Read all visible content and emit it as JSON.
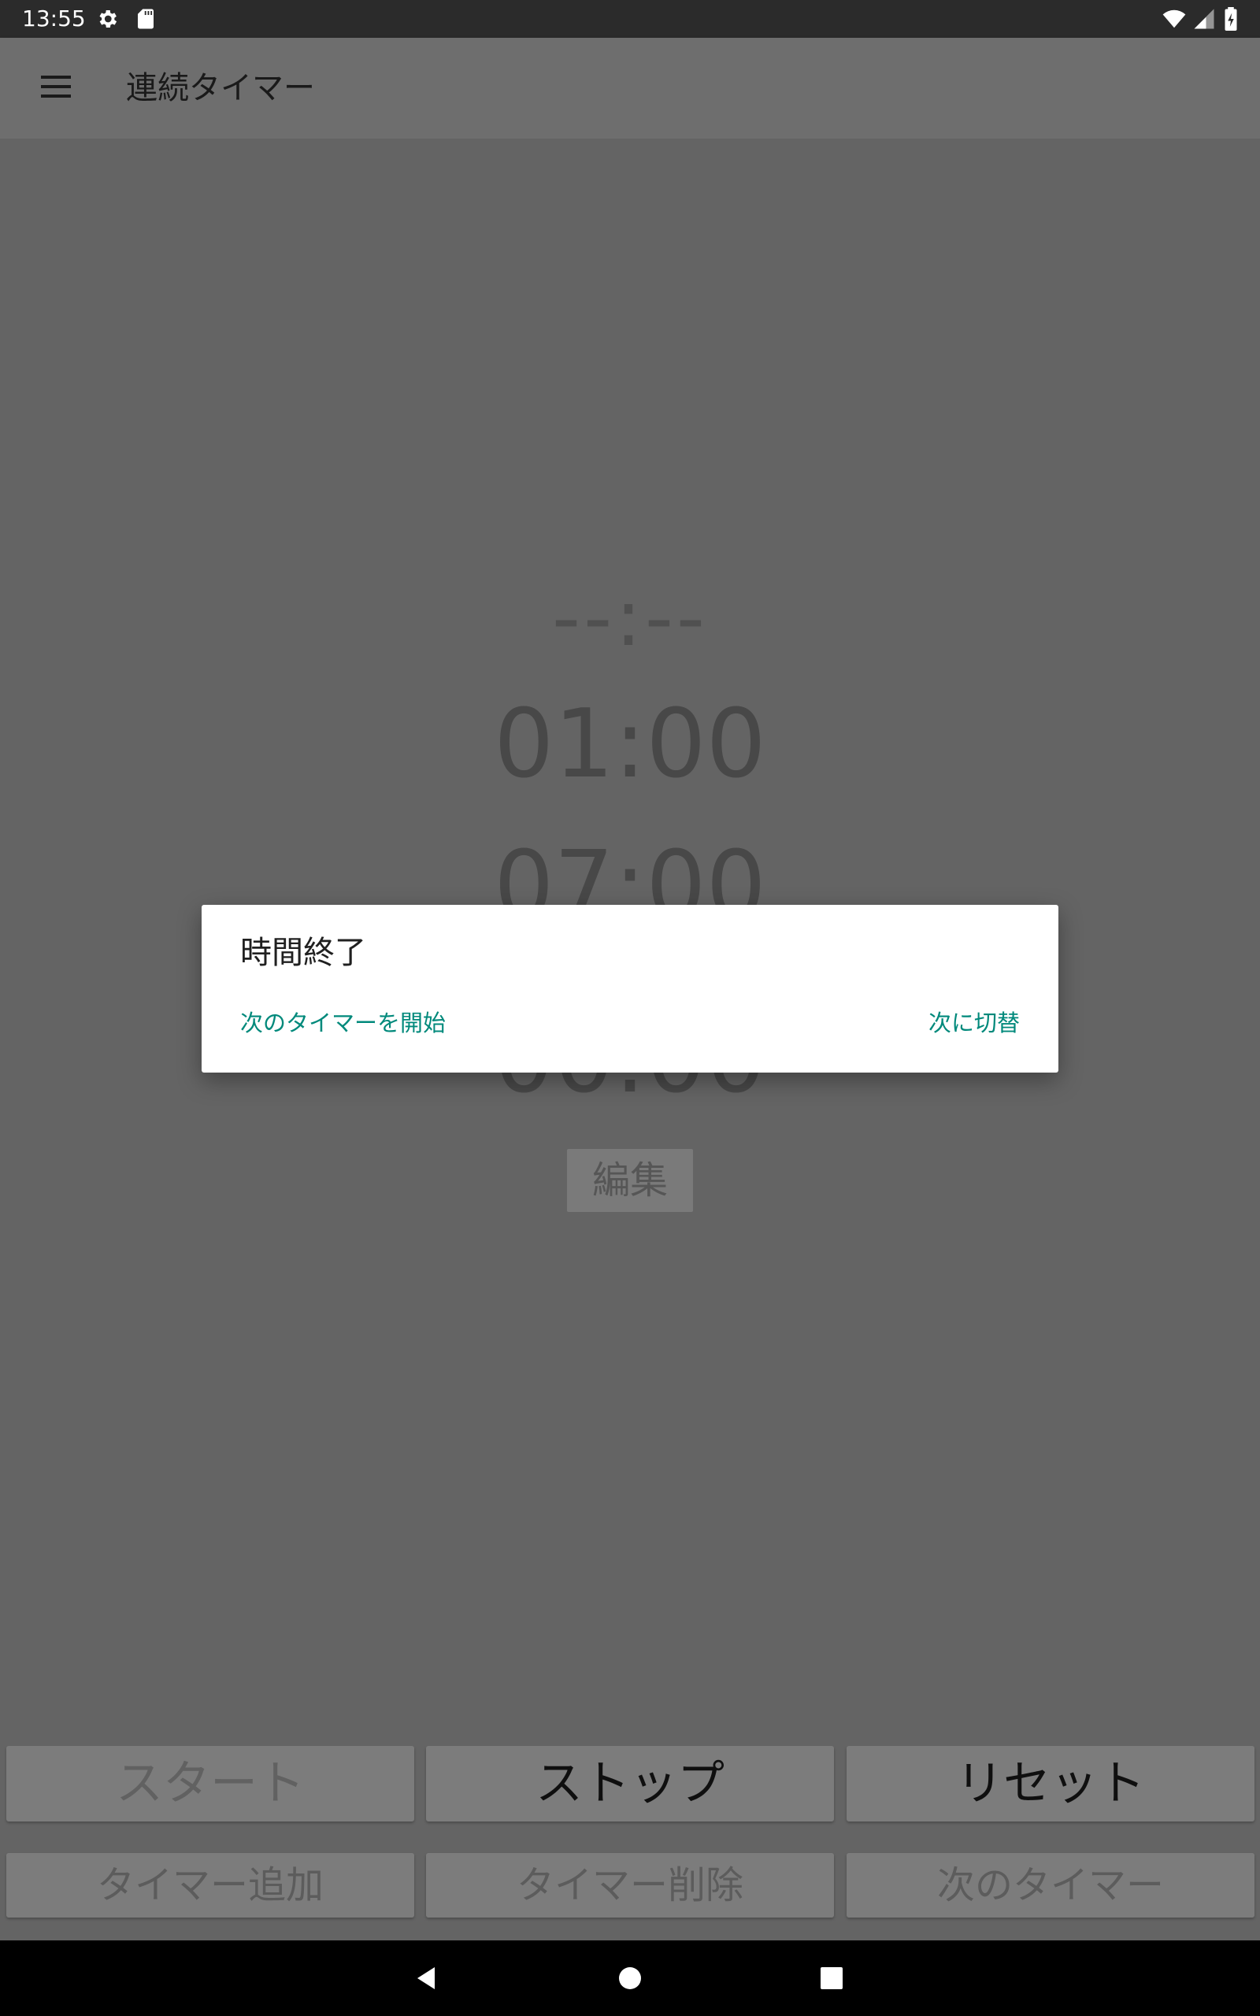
{
  "status_bar": {
    "time": "13:55",
    "icons": [
      "settings-icon",
      "sd-card-icon",
      "wifi-icon",
      "signal-icon",
      "battery-icon"
    ]
  },
  "app_bar": {
    "title": "連続タイマー",
    "menu_icon": "menu-icon"
  },
  "timers": {
    "current": "--:--",
    "list": [
      "01:00",
      "07:00",
      "00:00"
    ]
  },
  "edit_button": "編集",
  "buttons": {
    "start": "スタート",
    "stop": "ストップ",
    "reset": "リセット",
    "add_timer": "タイマー追加",
    "delete_timer": "タイマー削除",
    "next_timer": "次のタイマー"
  },
  "dialog": {
    "title": "時間終了",
    "action_start_next": "次のタイマーを開始",
    "action_switch_next": "次に切替"
  },
  "colors": {
    "accent": "#00897b",
    "scrim_background": "#646464",
    "status_bar": "#2b2b2b",
    "nav_bar": "#000000"
  },
  "nav_bar": {
    "icons": [
      "back-icon",
      "home-icon",
      "recents-icon"
    ]
  }
}
